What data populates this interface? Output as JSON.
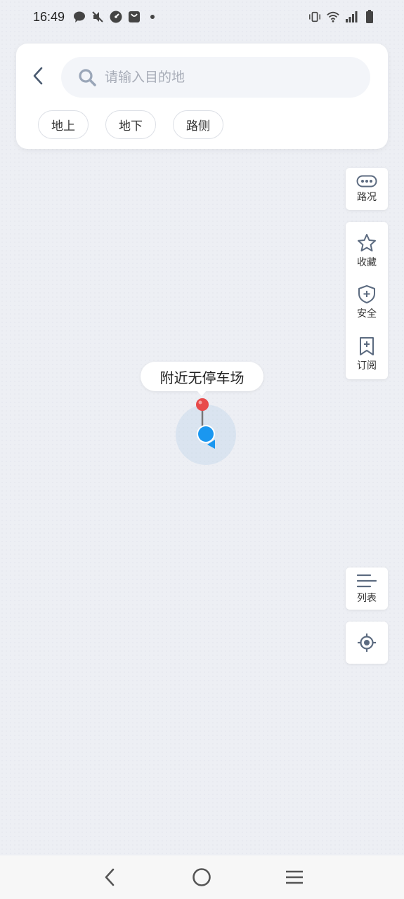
{
  "status_bar": {
    "time": "16:49",
    "left_icons": [
      "chat-bubble-icon",
      "muted-sound-icon",
      "speedometer-icon",
      "shopping-bag-icon",
      "dot-icon"
    ],
    "right_icons": [
      "vibrate-icon",
      "wifi-icon",
      "signal-icon",
      "battery-icon"
    ]
  },
  "search": {
    "placeholder": "请输入目的地",
    "value": ""
  },
  "filters": [
    {
      "label": "地上"
    },
    {
      "label": "地下"
    },
    {
      "label": "路侧"
    }
  ],
  "tools": {
    "traffic": {
      "label": "路况",
      "icon": "traffic-icon"
    },
    "favorites": {
      "label": "收藏",
      "icon": "star-icon"
    },
    "safety": {
      "label": "安全",
      "icon": "shield-icon"
    },
    "subscribe": {
      "label": "订阅",
      "icon": "bookmark-plus-icon"
    },
    "list": {
      "label": "列表",
      "icon": "list-icon"
    },
    "locate": {
      "icon": "locate-icon"
    }
  },
  "map": {
    "tooltip": "附近无停车场"
  },
  "colors": {
    "accent_blue": "#1a97f0",
    "pin_red": "#e84a4a",
    "map_bg": "#edeff4"
  },
  "nav_bar": {
    "icons": [
      "back-icon",
      "home-icon",
      "menu-icon"
    ]
  }
}
